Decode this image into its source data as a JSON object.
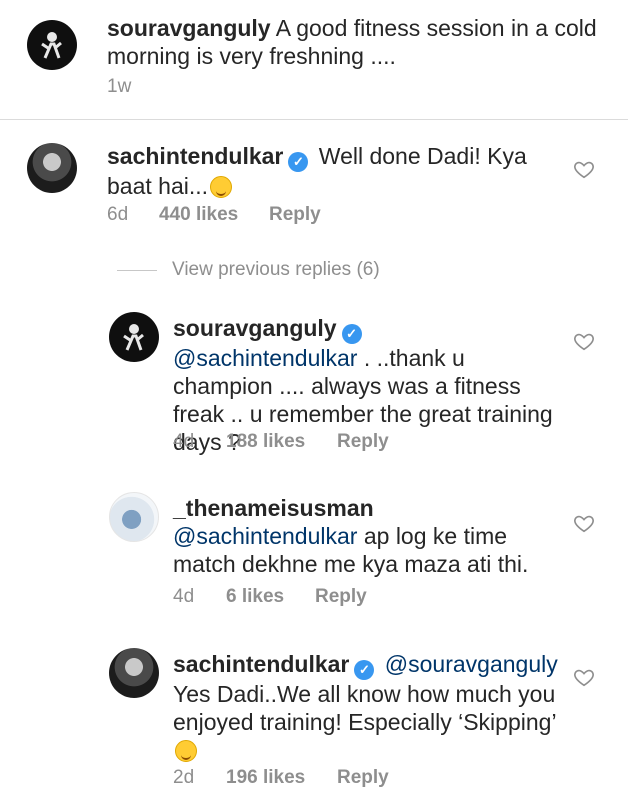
{
  "caption": {
    "username": "souravganguly",
    "text": "A good fitness session in a cold morning is very freshning ....",
    "time": "1w"
  },
  "comments": [
    {
      "username": "sachintendulkar",
      "verified": true,
      "text": "Well done Dadi! Kya baat hai...",
      "emoji": "winking-face",
      "time": "6d",
      "likes": "440 likes",
      "reply": "Reply"
    }
  ],
  "view_previous_replies": "View previous replies (6)",
  "replies": [
    {
      "username": "souravganguly",
      "verified": true,
      "mention": "@sachintendulkar",
      "text": ". ..thank u champion .... always was a fitness freak .. u remember the great training days ?",
      "time": "4d",
      "likes": "188 likes",
      "reply": "Reply"
    },
    {
      "username": "_thenameisusman",
      "verified": false,
      "mention": "@sachintendulkar",
      "text": "ap log ke time match dekhne me kya maza ati thi.",
      "time": "4d",
      "likes": "6 likes",
      "reply": "Reply"
    },
    {
      "username": "sachintendulkar",
      "verified": true,
      "mention": "@souravganguly",
      "text": "Yes Dadi..We all know how much you enjoyed training! Especially ‘Skipping’",
      "emoji": "face-savoring-food",
      "time": "2d",
      "likes": "196 likes",
      "reply": "Reply"
    }
  ],
  "icons": {
    "like": "heart-outline-icon",
    "verified": "verified-badge-icon"
  },
  "colors": {
    "verified": "#3897f0",
    "mention": "#003569",
    "meta": "#8e8e8e"
  }
}
